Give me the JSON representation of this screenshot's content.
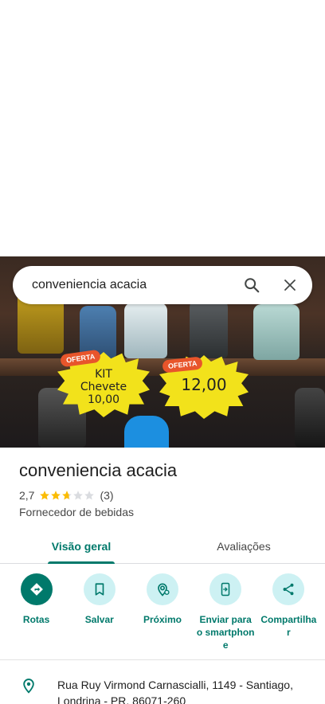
{
  "search": {
    "query": "conveniencia acacia"
  },
  "photo": {
    "tag1_oferta": "OFERTA",
    "tag1_lines": [
      "KIT",
      "Chevete",
      "10,00"
    ],
    "tag2_oferta": "OFERTA",
    "tag2_price": "12,00"
  },
  "place": {
    "name": "conveniencia acacia",
    "rating": "2,7",
    "stars": 2.7,
    "review_count": "(3)",
    "category": "Fornecedor de bebidas"
  },
  "tabs": [
    {
      "label": "Visão geral",
      "active": true
    },
    {
      "label": "Avaliações",
      "active": false
    }
  ],
  "actions": [
    {
      "label": "Rotas",
      "icon": "directions-icon"
    },
    {
      "label": "Salvar",
      "icon": "bookmark-icon"
    },
    {
      "label": "Próximo",
      "icon": "nearby-icon"
    },
    {
      "label": "Enviar para o smartphone",
      "icon": "send-to-phone-icon"
    },
    {
      "label": "Compartilhar",
      "icon": "share-icon"
    }
  ],
  "address": "Rua Ruy Virmond Carnascialli, 1149 - Santiago, Londrina - PR, 86071-260",
  "colors": {
    "accent": "#00796b",
    "action_bg": "#cdf1f3",
    "star": "#fbbc04"
  }
}
